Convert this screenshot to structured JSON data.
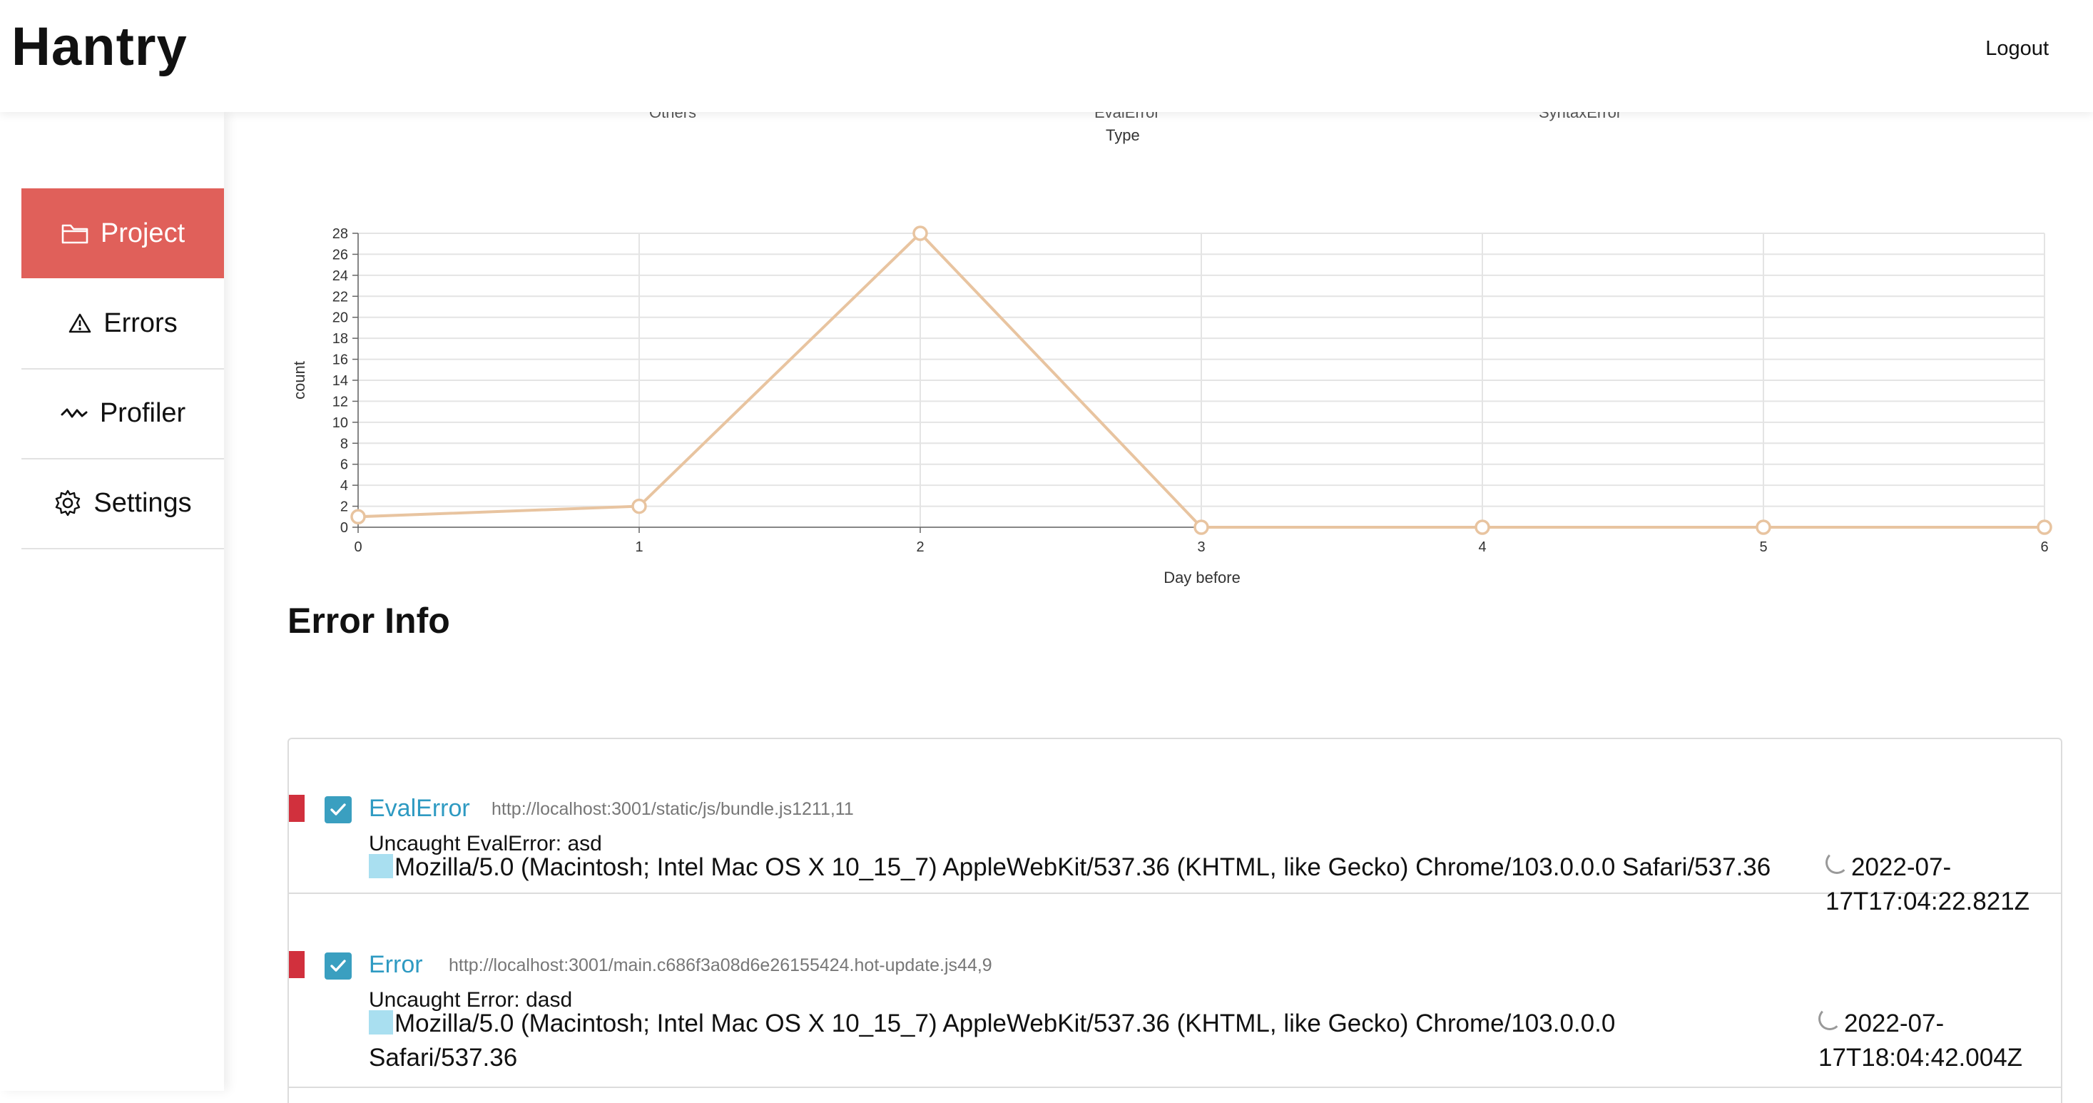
{
  "header": {
    "brand": "Hantry",
    "logout_label": "Logout"
  },
  "sidebar": {
    "items": [
      {
        "label": "Project",
        "icon": "folder-icon",
        "active": true
      },
      {
        "label": "Errors",
        "icon": "warning-icon",
        "active": false
      },
      {
        "label": "Profiler",
        "icon": "wave-icon",
        "active": false
      },
      {
        "label": "Settings",
        "icon": "gear-icon",
        "active": false
      }
    ]
  },
  "top_chart": {
    "cut_labels": [
      "Others",
      "EvalError",
      "SyntaxError"
    ],
    "xlabel": "Type"
  },
  "chart_data": {
    "type": "line",
    "x": [
      0,
      1,
      2,
      3,
      4,
      5,
      6
    ],
    "series": [
      {
        "values": [
          1,
          2,
          28,
          0,
          0,
          0,
          0
        ],
        "color": "#e8c4a0"
      }
    ],
    "xlabel": "Day before",
    "ylabel": "count",
    "ylim": [
      0,
      28
    ],
    "yticks": [
      0,
      2,
      4,
      6,
      8,
      10,
      12,
      14,
      16,
      18,
      20,
      22,
      24,
      26,
      28
    ],
    "grid": true
  },
  "error_info": {
    "title": "Error Info",
    "items": [
      {
        "name": "EvalError",
        "url": "http://localhost:3001/static/js/bundle.js1211,11",
        "message": "Uncaught EvalError: asd",
        "user_agent": "Mozilla/5.0 (Macintosh; Intel Mac OS X 10_15_7) AppleWebKit/537.36 (KHTML, like Gecko) Chrome/103.0.0.0 Safari/537.36",
        "timestamp": "2022-07-17T17:04:22.821Z"
      },
      {
        "name": "Error",
        "url": "http://localhost:3001/main.c686f3a08d6e26155424.hot-update.js44,9",
        "message": "Uncaught Error: dasd",
        "user_agent_line1": "Mozilla/5.0 (Macintosh; Intel Mac OS X 10_15_7) AppleWebKit/537.36 (KHTML, like Gecko) Chrome/103.0.0.0",
        "user_agent_line2": "Safari/537.36",
        "timestamp_line1": "2022-07-",
        "timestamp_line2": "17T18:04:42.004Z"
      }
    ]
  },
  "colors": {
    "accent": "#e0605a",
    "error_marker": "#d1303d",
    "checkbox": "#3a9fc0",
    "error_name": "#2e9ac2"
  }
}
